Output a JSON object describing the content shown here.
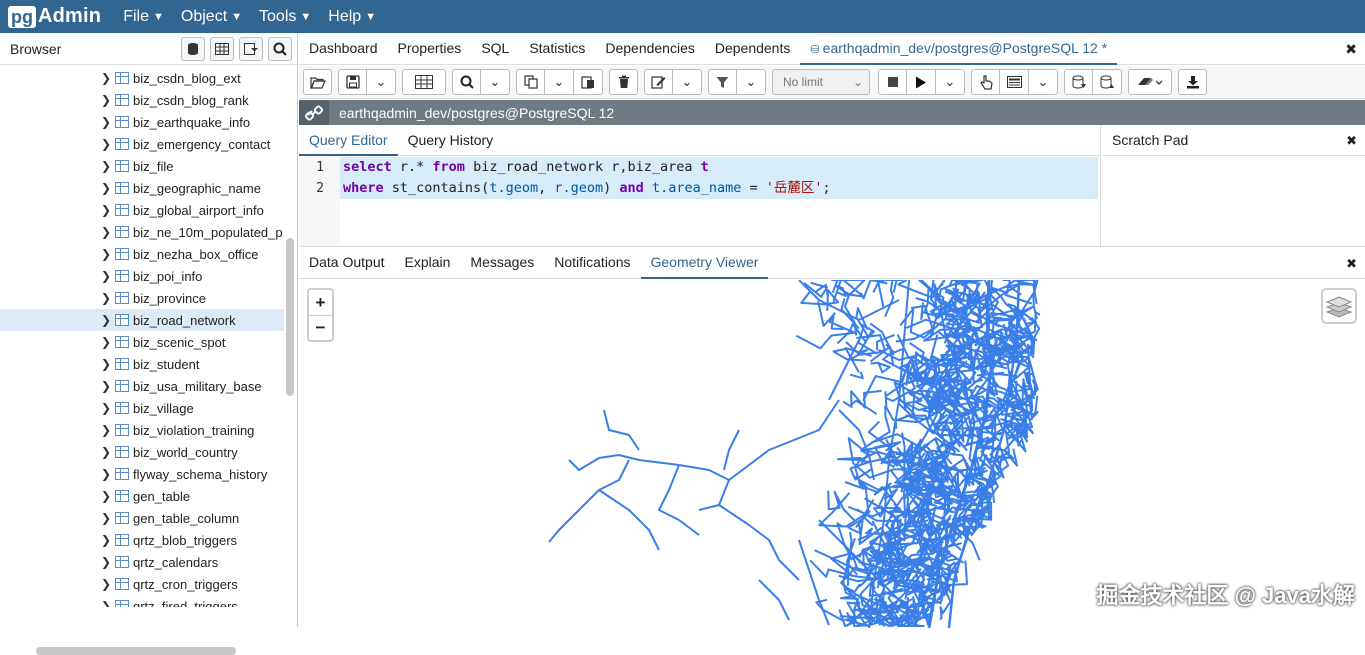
{
  "app": {
    "logo_pg": "pg",
    "logo_admin": "Admin"
  },
  "menu": [
    {
      "label": "File"
    },
    {
      "label": "Object"
    },
    {
      "label": "Tools"
    },
    {
      "label": "Help"
    }
  ],
  "browser": {
    "title": "Browser",
    "items": [
      "biz_csdn_blog_ext",
      "biz_csdn_blog_rank",
      "biz_earthquake_info",
      "biz_emergency_contact",
      "biz_file",
      "biz_geographic_name",
      "biz_global_airport_info",
      "biz_ne_10m_populated_p",
      "biz_nezha_box_office",
      "biz_poi_info",
      "biz_province",
      "biz_road_network",
      "biz_scenic_spot",
      "biz_student",
      "biz_usa_military_base",
      "biz_village",
      "biz_violation_training",
      "biz_world_country",
      "flyway_schema_history",
      "gen_table",
      "gen_table_column",
      "qrtz_blob_triggers",
      "qrtz_calendars",
      "qrtz_cron_triggers",
      "qrtz_fired_triggers"
    ],
    "selected_index": 11
  },
  "tabs": [
    "Dashboard",
    "Properties",
    "SQL",
    "Statistics",
    "Dependencies",
    "Dependents"
  ],
  "query_tab": "earthqadmin_dev/postgres@PostgreSQL 12 *",
  "toolbar": {
    "limit": "No limit"
  },
  "connection": "earthqadmin_dev/postgres@PostgreSQL 12",
  "editor_tabs": [
    "Query Editor",
    "Query History"
  ],
  "scratch_pad": "Scratch Pad",
  "code": {
    "line1": {
      "n": "1",
      "k1": "select",
      "t1": " r.* ",
      "k2": "from",
      "t2": " biz_road_network r,biz_area ",
      "k3": "t"
    },
    "line2": {
      "n": "2",
      "k1": "where",
      "t1": " st_contains(",
      "c1": "t.geom",
      "t2": ", ",
      "c2": "r.geom",
      "t3": ") ",
      "k2": "and",
      "t4": " ",
      "c3": "t.area_name",
      "t5": " = ",
      "s1": "'岳麓区'",
      "t6": ";"
    }
  },
  "result_tabs": [
    "Data Output",
    "Explain",
    "Messages",
    "Notifications",
    "Geometry Viewer"
  ],
  "zoom": {
    "plus": "+",
    "minus": "−"
  },
  "watermark": "掘金技术社区 @ Java水解",
  "colors": {
    "brand": "#326690",
    "road": "#3a7ee8"
  }
}
